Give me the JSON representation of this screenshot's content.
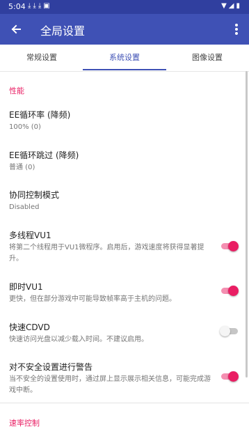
{
  "status_bar": {
    "time": "5:04",
    "notif_icons": [
      "download-icon",
      "download-icon",
      "download-icon",
      "text-a-icon"
    ],
    "sys_icons": [
      "wifi-icon",
      "signal-icon",
      "battery-icon"
    ]
  },
  "app_bar": {
    "title": "全局设置",
    "back_icon": "back-arrow-icon",
    "more_icon": "more-vert-icon"
  },
  "tabs": [
    {
      "label": "常规设置"
    },
    {
      "label": "系统设置",
      "selected": true
    },
    {
      "label": "图像设置"
    }
  ],
  "sections": {
    "performance": "性能",
    "speed_control": "速率控制"
  },
  "settings": {
    "ee_cycle_rate": {
      "title": "EE循环率 (降频)",
      "value": "100% (0)"
    },
    "ee_cycle_skip": {
      "title": "EE循环跳过 (降频)",
      "value": "普通 (0)"
    },
    "sync_mode": {
      "title": "协同控制模式",
      "value": "Disabled"
    },
    "mtvu": {
      "title": "多线程VU1",
      "summary": "将第二个线程用于VU1微程序。启用后，游戏速度将获得显著提升。",
      "enabled": true
    },
    "instant_vu1": {
      "title": "即时VU1",
      "summary": "更快，但在部分游戏中可能导致帧率高于主机的问题。",
      "enabled": true
    },
    "fast_cdvd": {
      "title": "快速CDVD",
      "summary": "快速访问光盘以减少载入时间。不建议启用。",
      "enabled": false
    },
    "unsafe_warning": {
      "title": "对不安全设置进行警告",
      "summary": "当不安全的设置使用时，通过屏上显示展示相关信息，可能完成游戏中断。",
      "enabled": true
    }
  },
  "colors": {
    "primary": "#3f51b5",
    "primary_dark": "#303f9f",
    "accent": "#e91e63"
  }
}
